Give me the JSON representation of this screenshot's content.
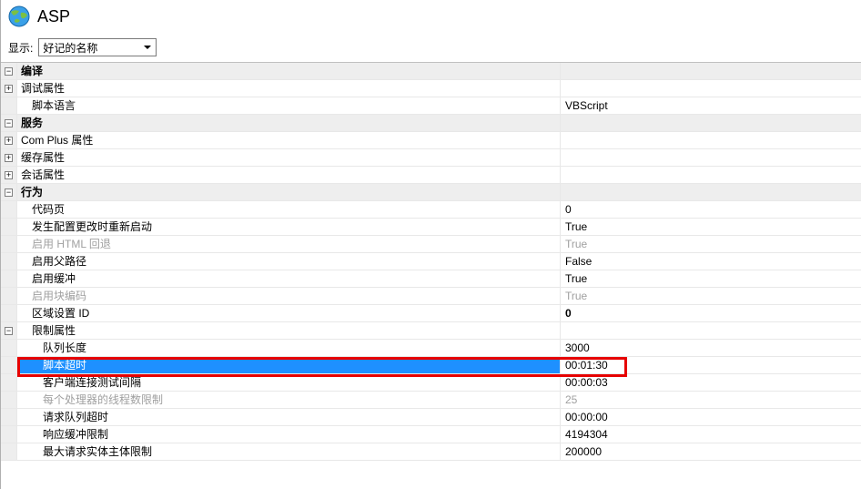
{
  "title": "ASP",
  "display": {
    "label": "显示:",
    "selected": "好记的名称"
  },
  "toggle": {
    "plus": "+",
    "minus": "−"
  },
  "categories": {
    "compile": "编译",
    "debug_props": "调试属性",
    "script_lang": {
      "label": "脚本语言",
      "value": "VBScript"
    },
    "services": "服务",
    "complus_props": "Com Plus 属性",
    "cache_props": "缓存属性",
    "session_props": "会话属性",
    "behavior": "行为"
  },
  "behavior": {
    "code_page": {
      "label": "代码页",
      "value": "0"
    },
    "restart_on_cfg": {
      "label": "发生配置更改时重新启动",
      "value": "True"
    },
    "enable_html_fallback": {
      "label": "启用 HTML 回退",
      "value": "True"
    },
    "enable_parent_path": {
      "label": "启用父路径",
      "value": "False"
    },
    "enable_buffering": {
      "label": "启用缓冲",
      "value": "True"
    },
    "enable_chunked": {
      "label": "启用块编码",
      "value": "True"
    },
    "locale_id": {
      "label": "区域设置 ID",
      "value": "0"
    },
    "limits": "限制属性"
  },
  "limits": {
    "queue_length": {
      "label": "队列长度",
      "value": "3000"
    },
    "script_timeout": {
      "label": "脚本超时",
      "value": "00:01:30"
    },
    "client_conn_test_interval": {
      "label": "客户端连接测试间隔",
      "value": "00:00:03"
    },
    "threads_per_processor": {
      "label": "每个处理器的线程数限制",
      "value": "25"
    },
    "request_queue_timeout": {
      "label": "请求队列超时",
      "value": "00:00:00"
    },
    "response_buffer_limit": {
      "label": "响应缓冲限制",
      "value": "4194304"
    },
    "max_request_entity": {
      "label": "最大请求实体主体限制",
      "value": "200000"
    }
  }
}
